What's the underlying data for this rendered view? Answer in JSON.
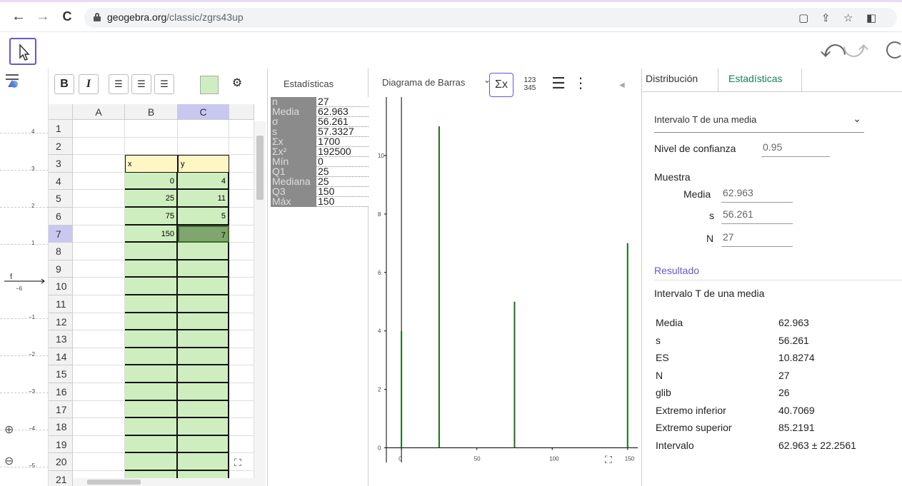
{
  "browser": {
    "url_host": "geogebra.org",
    "url_path": "/classic/zgrs43up"
  },
  "spreadsheet": {
    "columns": [
      "A",
      "B",
      "C"
    ],
    "rows": [
      "1",
      "2",
      "3",
      "4",
      "5",
      "6",
      "7",
      "8",
      "9",
      "10",
      "11",
      "12",
      "13",
      "14",
      "15",
      "16",
      "17",
      "18",
      "19",
      "20",
      "21"
    ],
    "header_x": "x",
    "header_y": "y",
    "data": [
      {
        "x": "0",
        "y": "4"
      },
      {
        "x": "25",
        "y": "11"
      },
      {
        "x": "75",
        "y": "5"
      },
      {
        "x": "150",
        "y": "7"
      }
    ],
    "selected_row": "7",
    "selected_col": "C"
  },
  "graphics": {
    "y_labels": [
      "4",
      "3",
      "2",
      "1",
      "−1",
      "−2",
      "−3",
      "−4",
      "−5"
    ],
    "x_label": "−6",
    "f_label": "f"
  },
  "stats": {
    "title": "Estadísticas",
    "rows": [
      {
        "k": "n",
        "v": "27"
      },
      {
        "k": "Media",
        "v": "62.963"
      },
      {
        "k": "σ",
        "v": "56.261"
      },
      {
        "k": "s",
        "v": "57.3327"
      },
      {
        "k": "Σx",
        "v": "1700"
      },
      {
        "k": "Σx²",
        "v": "192500"
      },
      {
        "k": "Mín",
        "v": "0"
      },
      {
        "k": "Q1",
        "v": "25"
      },
      {
        "k": "Mediana",
        "v": "25"
      },
      {
        "k": "Q3",
        "v": "150"
      },
      {
        "k": "Máx",
        "v": "150"
      }
    ]
  },
  "chart_panel": {
    "type_label": "Diagrama de Barras",
    "tool_sigma": "Σx",
    "tool_123": "123",
    "tool_345": "345"
  },
  "chart_data": {
    "type": "bar",
    "x": [
      0,
      25,
      75,
      150
    ],
    "values": [
      4,
      11,
      5,
      7
    ],
    "xlim": [
      -10,
      152
    ],
    "ylim": [
      -0.5,
      12
    ],
    "x_ticks": [
      "0",
      "50",
      "100",
      "150"
    ],
    "y_ticks": [
      "0",
      "2",
      "4",
      "6",
      "8",
      "10"
    ],
    "bar_color": "#1a6b1a"
  },
  "probability": {
    "tab_distribution": "Distribución",
    "tab_statistics": "Estadísticas",
    "procedure": "Intervalo T de una media",
    "confidence_label": "Nivel de confianza",
    "confidence_value": "0.95",
    "sample_label": "Muestra",
    "mean_label": "Media",
    "mean_value": "62.963",
    "s_label": "s",
    "s_value": "56.261",
    "n_label": "N",
    "n_value": "27",
    "result_title": "Resultado",
    "result_subtitle": "Intervalo T de una media",
    "results": [
      {
        "k": "Media",
        "v": "62.963"
      },
      {
        "k": "s",
        "v": "56.261"
      },
      {
        "k": "ES",
        "v": "10.8274"
      },
      {
        "k": "N",
        "v": "27"
      },
      {
        "k": "glib",
        "v": "26"
      },
      {
        "k": "Extremo inferior",
        "v": "40.7069"
      },
      {
        "k": "Extremo superior",
        "v": "85.2191"
      },
      {
        "k": "Intervalo",
        "v": "62.963 ± 22.2561"
      }
    ]
  }
}
